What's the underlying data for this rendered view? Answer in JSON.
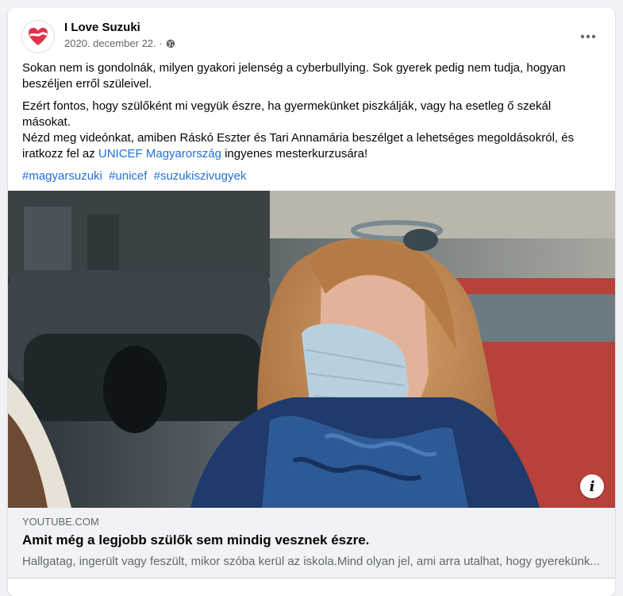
{
  "post": {
    "page_name": "I Love Suzuki",
    "date": "2020. december 22.",
    "separator": "·",
    "paragraph1": "Sokan nem is gondolnák, milyen gyakori jelenség a cyberbullying. Sok gyerek pedig nem tudja, hogyan beszéljen erről szüleivel.",
    "paragraph2_line1": "Ezért fontos, hogy szülőként mi vegyük észre, ha gyermekünket piszkálják, vagy ha esetleg ő szekál másokat.",
    "paragraph2_line2_before": "Nézd meg videónkat, amiben Ráskó Eszter és Tari Annamária beszélget a lehetséges megoldásokról, és iratkozz fel az ",
    "mention": "UNICEF Magyarország",
    "paragraph2_line2_after": " ingyenes mesterkurzusára!",
    "hashtags": [
      "#magyarsuzuki",
      "#unicef",
      "#suzukiszivugyek"
    ],
    "icons": {
      "avatar": "heart-logo-icon",
      "privacy": "globe-icon",
      "more": "more-horizontal-icon",
      "info": "info-icon"
    }
  },
  "link_preview": {
    "domain": "YOUTUBE.COM",
    "title": "Amit még a legjobb szülők sem mindig vesznek észre.",
    "description": "Hallgatag, ingerült vagy feszült, mikor szóba kerül az iskola.Mind olyan jel, ami arra utalhat, hogy gyerekünk...",
    "info_glyph": "i"
  },
  "colors": {
    "link": "#216fdb",
    "secondary_text": "#65676b",
    "brand_red": "#e0334c"
  }
}
